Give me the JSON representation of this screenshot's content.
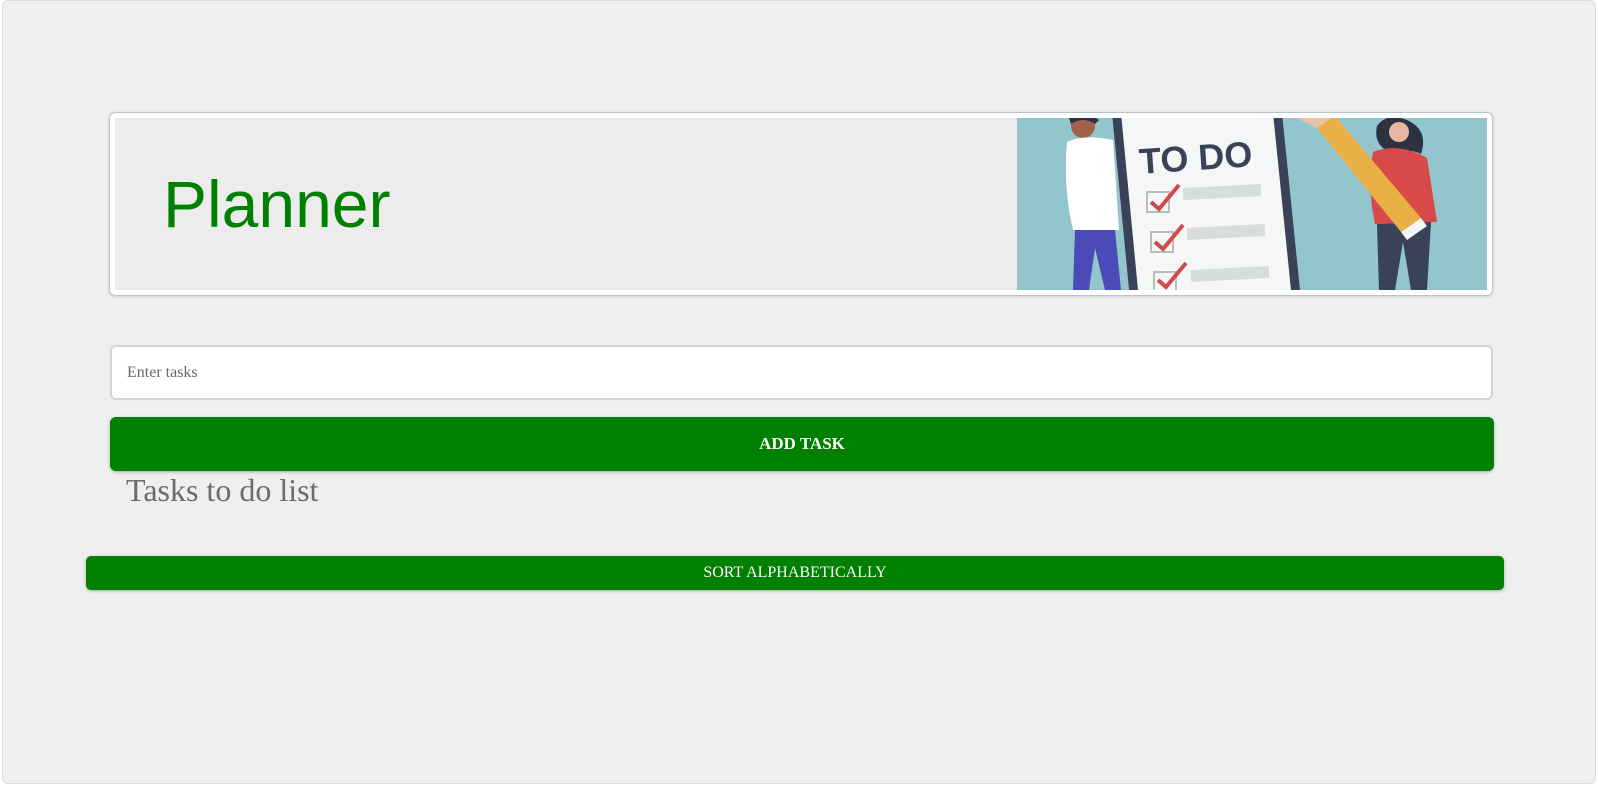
{
  "header": {
    "title": "Planner",
    "illustration_text": "TO DO",
    "illustration_colors": {
      "background": "#92c5cc",
      "board": "#f5f6f6",
      "board_edge": "#3a4257",
      "checkmark": "#cf4b4b",
      "pencil": "#e8b045",
      "person_left_shirt": "#ffffff",
      "person_left_pants": "#4a4ab8",
      "person_right_shirt": "#d84a4a"
    }
  },
  "task_input": {
    "placeholder": "Enter tasks",
    "value": ""
  },
  "add_button": {
    "label": "ADD TASK"
  },
  "list": {
    "heading": "Tasks to do list",
    "items": []
  },
  "sort_button": {
    "label": "SORT ALPHABETICALLY"
  },
  "colors": {
    "accent": "#008000",
    "page_background": "#efefef",
    "heading_text": "#6b6b6b"
  }
}
